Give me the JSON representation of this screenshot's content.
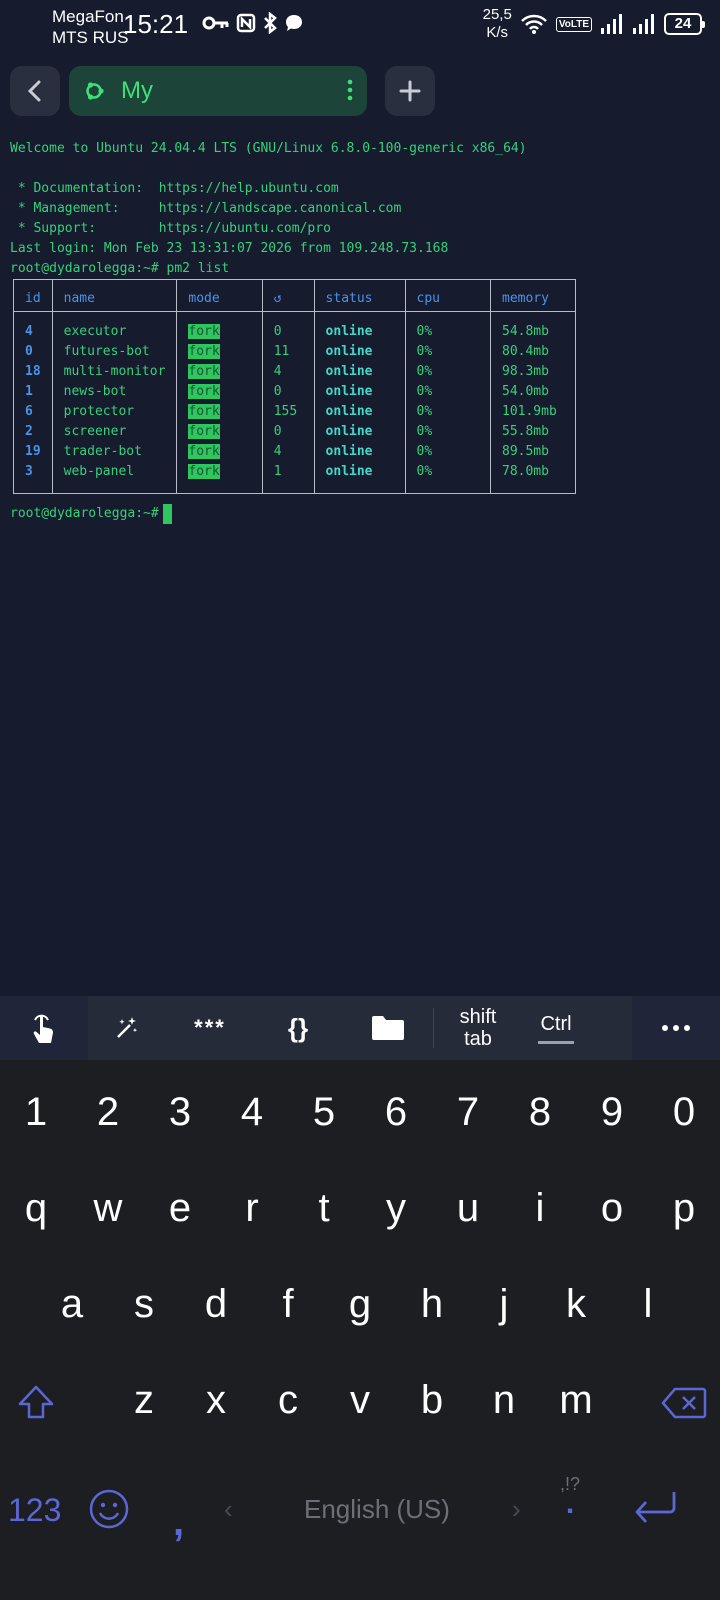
{
  "statusbar": {
    "carrier1": "MegaFon",
    "carrier2": "MTS RUS",
    "time": "15:21",
    "net_speed_value": "25,5",
    "net_speed_unit": "K/s",
    "volte": "VoLTE",
    "battery": "24"
  },
  "tabbar": {
    "session_title": "My",
    "icons": [
      "chevron-left-icon",
      "ubuntu-icon",
      "more-vert-icon",
      "plus-icon"
    ]
  },
  "terminal": {
    "lines": [
      "Welcome to Ubuntu 24.04.4 LTS (GNU/Linux 6.8.0-100-generic x86_64)",
      "",
      " * Documentation:  https://help.ubuntu.com",
      " * Management:     https://landscape.canonical.com",
      " * Support:        https://ubuntu.com/pro",
      "Last login: Mon Feb 23 13:31:07 2026 from 109.248.73.168",
      "root@dydarolegga:~# pm2 list"
    ],
    "table": {
      "headers": [
        "id",
        "name",
        "mode",
        "↺",
        "status",
        "cpu",
        "memory"
      ],
      "rows": [
        {
          "id": "4",
          "name": "executor",
          "mode": "fork",
          "restarts": "0",
          "status": "online",
          "cpu": "0%",
          "memory": "54.8mb"
        },
        {
          "id": "0",
          "name": "futures-bot",
          "mode": "fork",
          "restarts": "11",
          "status": "online",
          "cpu": "0%",
          "memory": "80.4mb"
        },
        {
          "id": "18",
          "name": "multi-monitor",
          "mode": "fork",
          "restarts": "4",
          "status": "online",
          "cpu": "0%",
          "memory": "98.3mb"
        },
        {
          "id": "1",
          "name": "news-bot",
          "mode": "fork",
          "restarts": "0",
          "status": "online",
          "cpu": "0%",
          "memory": "54.0mb"
        },
        {
          "id": "6",
          "name": "protector",
          "mode": "fork",
          "restarts": "155",
          "status": "online",
          "cpu": "0%",
          "memory": "101.9mb"
        },
        {
          "id": "2",
          "name": "screener",
          "mode": "fork",
          "restarts": "0",
          "status": "online",
          "cpu": "0%",
          "memory": "55.8mb"
        },
        {
          "id": "19",
          "name": "trader-bot",
          "mode": "fork",
          "restarts": "4",
          "status": "online",
          "cpu": "0%",
          "memory": "89.5mb"
        },
        {
          "id": "3",
          "name": "web-panel",
          "mode": "fork",
          "restarts": "1",
          "status": "online",
          "cpu": "0%",
          "memory": "78.0mb"
        }
      ]
    },
    "prompt": "root@dydarolegga:~#"
  },
  "extrakeys": {
    "stars": "***",
    "braces": "{}",
    "shift_tab_1": "shift",
    "shift_tab_2": "tab",
    "ctrl": "Ctrl",
    "icons": [
      "touch-icon",
      "magic-wand-icon",
      "folder-icon",
      "more-horiz-icon"
    ]
  },
  "keyboard": {
    "numbers": [
      "1",
      "2",
      "3",
      "4",
      "5",
      "6",
      "7",
      "8",
      "9",
      "0"
    ],
    "row1": [
      "q",
      "w",
      "e",
      "r",
      "t",
      "y",
      "u",
      "i",
      "o",
      "p"
    ],
    "row2": [
      "a",
      "s",
      "d",
      "f",
      "g",
      "h",
      "j",
      "k",
      "l"
    ],
    "row3": [
      "z",
      "x",
      "c",
      "v",
      "b",
      "n",
      "m"
    ],
    "num_switch": "123",
    "comma": ",",
    "space_label": "English (US)",
    "punct_hint": ",!?",
    "period": "."
  }
}
